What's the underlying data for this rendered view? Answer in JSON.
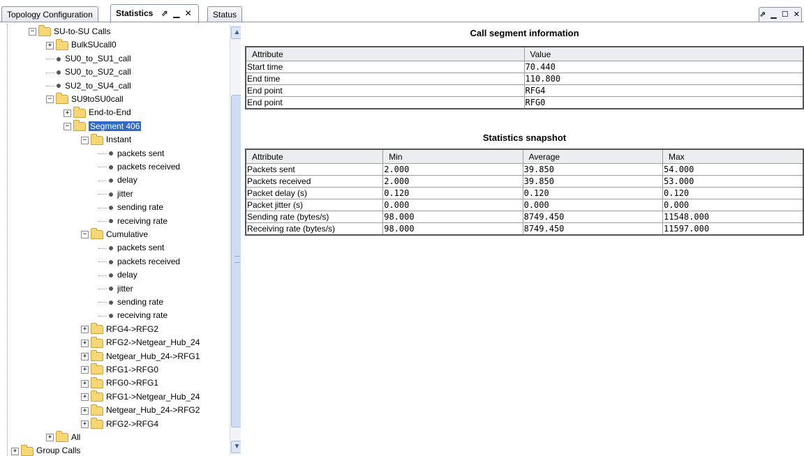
{
  "tabs": [
    {
      "label": "Topology Configuration",
      "active": false
    },
    {
      "label": "Statistics",
      "active": true,
      "controls": "⇗ ▁ ✕"
    },
    {
      "label": "Status",
      "active": false
    }
  ],
  "window_controls": "⇗ ▁ ☐ ✕",
  "tree": {
    "items": [
      {
        "label": "SU-to-SU Calls",
        "type": "folder",
        "expander": "−"
      },
      {
        "label": "BulkSUcall0",
        "type": "folder",
        "expander": "+"
      },
      {
        "label": "SU0_to_SU1_call",
        "type": "leaf"
      },
      {
        "label": "SU0_to_SU2_call",
        "type": "leaf"
      },
      {
        "label": "SU2_to_SU4_call",
        "type": "leaf"
      },
      {
        "label": "SU9toSU0call",
        "type": "folder",
        "expander": "−"
      },
      {
        "label": "End-to-End",
        "type": "folder",
        "expander": "+"
      },
      {
        "label": "Segment 406",
        "type": "folder",
        "expander": "−",
        "selected": true
      },
      {
        "label": "Instant",
        "type": "folder",
        "expander": "−"
      },
      {
        "label": "packets sent",
        "type": "leaf"
      },
      {
        "label": "packets received",
        "type": "leaf"
      },
      {
        "label": "delay",
        "type": "leaf"
      },
      {
        "label": "jitter",
        "type": "leaf"
      },
      {
        "label": "sending rate",
        "type": "leaf"
      },
      {
        "label": "receiving rate",
        "type": "leaf"
      },
      {
        "label": "Cumulative",
        "type": "folder",
        "expander": "−"
      },
      {
        "label": "packets sent",
        "type": "leaf"
      },
      {
        "label": "packets received",
        "type": "leaf"
      },
      {
        "label": "delay",
        "type": "leaf"
      },
      {
        "label": "jitter",
        "type": "leaf"
      },
      {
        "label": "sending rate",
        "type": "leaf"
      },
      {
        "label": "receiving rate",
        "type": "leaf"
      },
      {
        "label": "RFG4->RFG2",
        "type": "folder",
        "expander": "+"
      },
      {
        "label": "RFG2->Netgear_Hub_24",
        "type": "folder",
        "expander": "+"
      },
      {
        "label": "Netgear_Hub_24->RFG1",
        "type": "folder",
        "expander": "+"
      },
      {
        "label": "RFG1->RFG0",
        "type": "folder",
        "expander": "+"
      },
      {
        "label": "RFG0->RFG1",
        "type": "folder",
        "expander": "+"
      },
      {
        "label": "RFG1->Netgear_Hub_24",
        "type": "folder",
        "expander": "+"
      },
      {
        "label": "Netgear_Hub_24->RFG2",
        "type": "folder",
        "expander": "+"
      },
      {
        "label": "RFG2->RFG4",
        "type": "folder",
        "expander": "+"
      },
      {
        "label": "All",
        "type": "folder",
        "expander": "+"
      },
      {
        "label": "Group Calls",
        "type": "folder",
        "expander": "+"
      }
    ]
  },
  "scrollbar": {
    "up": "▲",
    "down": "▼"
  },
  "call_segment": {
    "title": "Call segment information",
    "headers": [
      "Attribute",
      "Value"
    ],
    "rows": [
      [
        "Start time",
        "70.440"
      ],
      [
        "End time",
        "110.800"
      ],
      [
        "End point",
        "RFG4"
      ],
      [
        "End point",
        "RFG0"
      ]
    ]
  },
  "statistics": {
    "title": "Statistics snapshot",
    "headers": [
      "Attribute",
      "Min",
      "Average",
      "Max"
    ],
    "rows": [
      [
        "Packets sent",
        "2.000",
        "39.850",
        "54.000"
      ],
      [
        "Packets received",
        "2.000",
        "39.850",
        "53.000"
      ],
      [
        "Packet delay (s)",
        "0.120",
        "0.120",
        "0.120"
      ],
      [
        "Packet jitter (s)",
        "0.000",
        "0.000",
        "0.000"
      ],
      [
        "Sending rate (bytes/s)",
        "98.000",
        "8749.450",
        "11548.000"
      ],
      [
        "Receiving rate (bytes/s)",
        "98.000",
        "8749.450",
        "11597.000"
      ]
    ]
  }
}
